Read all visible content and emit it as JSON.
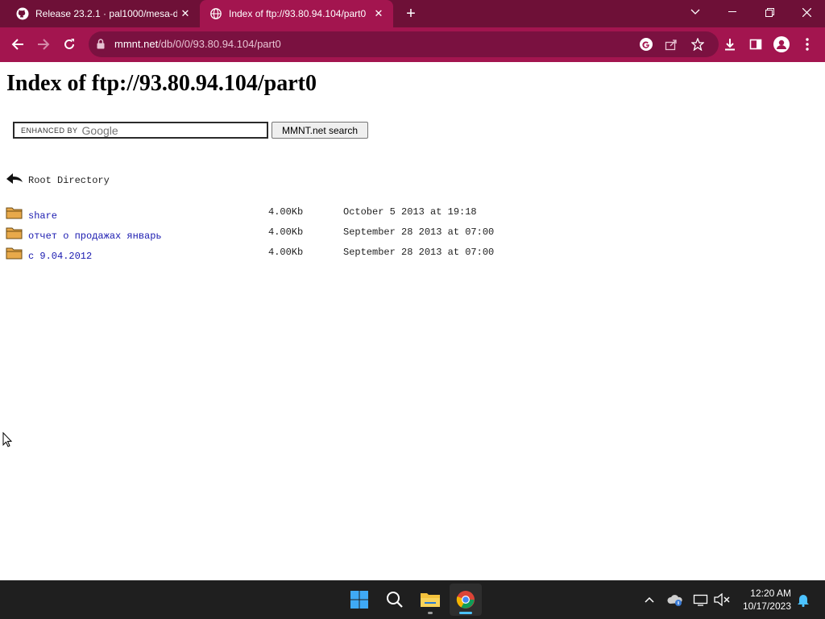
{
  "browser": {
    "tabs": [
      {
        "title": "Release 23.2.1 · pal1000/mesa-d",
        "active": false,
        "favicon": "github-icon"
      },
      {
        "title": "Index of ftp://93.80.94.104/part0",
        "active": true,
        "favicon": "globe-icon"
      }
    ],
    "url_host": "mmnt.net",
    "url_path": "/db/0/0/93.80.94.104/part0",
    "colors": {
      "tabbar": "#6e1037",
      "toolbar": "#a3154f",
      "omnibox": "#7a1140"
    }
  },
  "page": {
    "heading": "Index of ftp://93.80.94.104/part0",
    "search": {
      "enhanced_by": "ENHANCED BY",
      "google_word": "Google",
      "button_label": "MMNT.net search"
    },
    "root": {
      "label": "Root Directory"
    },
    "entries": [
      {
        "name": "share",
        "size": "4.00Kb",
        "date": "October 5 2013 at 19:18"
      },
      {
        "name": "отчет о продажах январь",
        "size": "4.00Kb",
        "date": "September 28 2013 at 07:00"
      },
      {
        "name": "с 9.04.2012",
        "size": "4.00Kb",
        "date": "September 28 2013 at 07:00"
      }
    ]
  },
  "taskbar": {
    "apps": [
      "windows-start-icon",
      "search-icon",
      "file-explorer-icon",
      "chrome-icon"
    ],
    "clock_time": "12:20 AM",
    "clock_date": "10/17/2023"
  }
}
